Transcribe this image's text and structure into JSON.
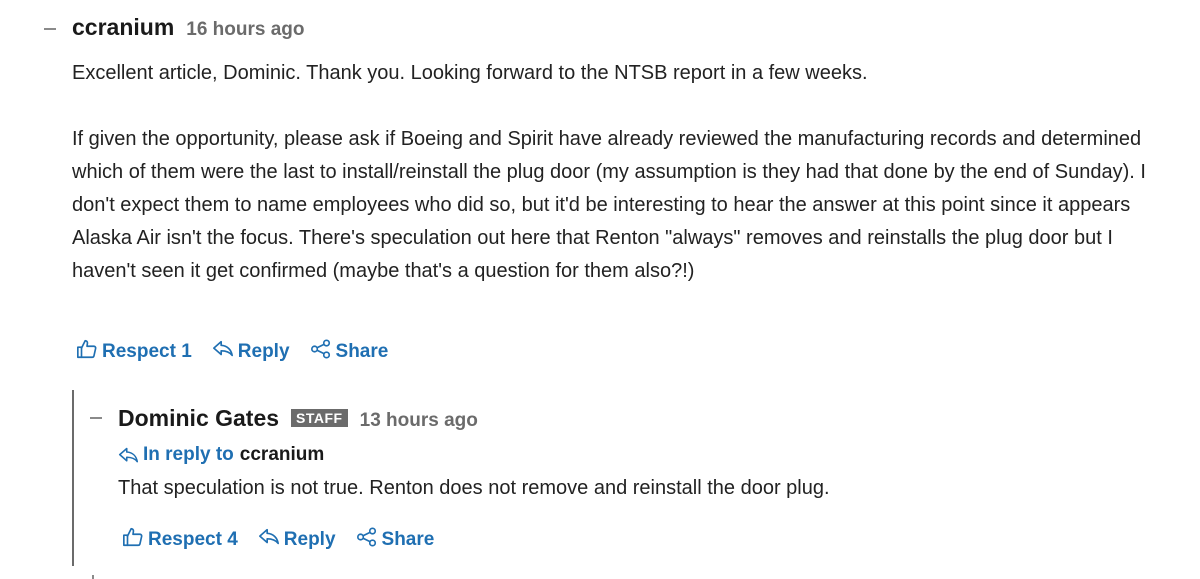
{
  "comment": {
    "author": "ccranium",
    "timestamp": "16 hours ago",
    "paragraphs": [
      "Excellent article, Dominic. Thank you. Looking forward to the NTSB report in a few weeks.",
      "If given the opportunity, please ask if Boeing and Spirit have already reviewed the manufacturing records and determined which of them were the last to install/reinstall the plug door (my assumption is they had that done by the end of Sunday). I don't expect them to name employees who did so, but it'd be interesting to hear the answer at this point since it appears Alaska Air isn't the focus. There's speculation out here that Renton \"always\" removes and reinstalls the plug door but I haven't seen it get confirmed (maybe that's a question for them also?!)"
    ],
    "actions": {
      "respect_label": "Respect 1",
      "reply_label": "Reply",
      "share_label": "Share"
    }
  },
  "reply": {
    "author": "Dominic Gates",
    "badge": "STAFF",
    "timestamp": "13 hours ago",
    "in_reply_label": "In reply to",
    "in_reply_target": "ccranium",
    "text": "That speculation is not true. Renton does not remove and reinstall the door plug.",
    "actions": {
      "respect_label": "Respect 4",
      "reply_label": "Reply",
      "share_label": "Share"
    }
  },
  "icons": {
    "respect": "thumbs-up-icon",
    "reply": "reply-arrow-icon",
    "share": "share-icon"
  },
  "colors": {
    "link": "#1f6fb2",
    "muted": "#6b6b6b",
    "text": "#222222",
    "badge_bg": "#6b6b6b"
  }
}
